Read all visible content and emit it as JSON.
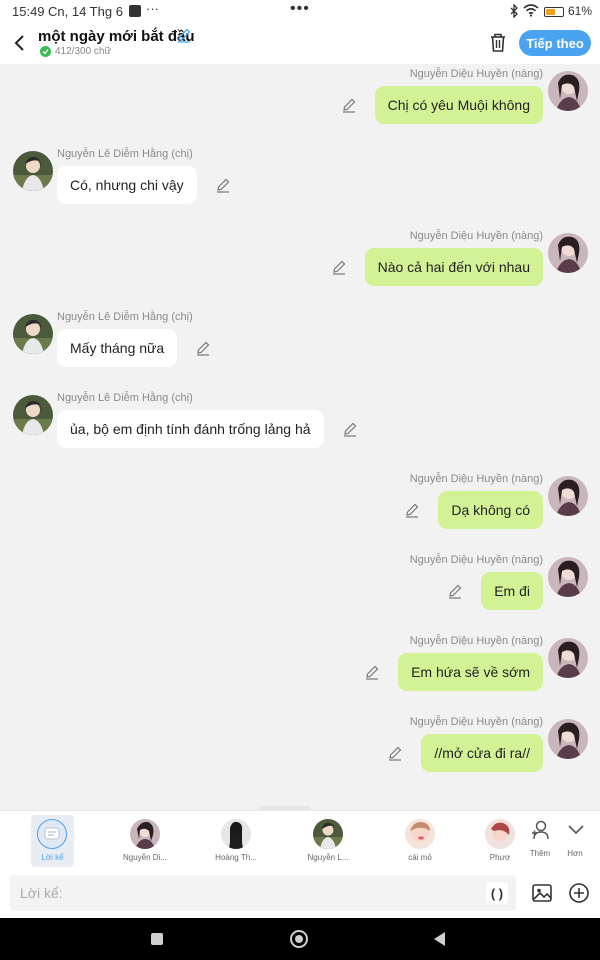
{
  "status_bar": {
    "time": "15:49",
    "date": "Cn, 14 Thg 6",
    "more": "···",
    "battery": "61%",
    "battery_level": 0.61
  },
  "header": {
    "title": "một ngày mới bắt đầu",
    "word_count": "412/300 chữ",
    "next_label": "Tiếp theo"
  },
  "characters": {
    "huyen": "Nguyễn Diệu Huyền (nàng)",
    "hang": "Nguyễn Lê Diễm Hằng (chị)"
  },
  "messages": [
    {
      "side": "right",
      "sender": "Nguyễn Diệu Huyền (nàng)",
      "text": "Chị có yêu Muội không"
    },
    {
      "side": "left",
      "sender": "Nguyễn Lê Diễm Hằng (chị)",
      "text": "Có, nhưng chi vậy"
    },
    {
      "side": "right",
      "sender": "Nguyễn Diệu Huyền (nàng)",
      "text": "Nào cả hai đến với nhau"
    },
    {
      "side": "left",
      "sender": "Nguyễn Lê Diễm Hằng (chị)",
      "text": "Mấy tháng nữa"
    },
    {
      "side": "left",
      "sender": "Nguyễn Lê Diễm Hằng (chị)",
      "text": "ủa, bộ em định tính đánh trống lảng hả"
    },
    {
      "side": "right",
      "sender": "Nguyễn Diệu Huyền (nàng)",
      "text": "Dạ không có"
    },
    {
      "side": "right",
      "sender": "Nguyễn Diệu Huyền (nàng)",
      "text": "Em đi"
    },
    {
      "side": "right",
      "sender": "Nguyễn Diệu Huyền (nàng)",
      "text": "Em hứa sẽ về sớm"
    },
    {
      "side": "right",
      "sender": "Nguyễn Diệu Huyền (nàng)",
      "text": "//mở cửa đi ra//"
    }
  ],
  "roles": [
    {
      "label": "Lời kể",
      "active": true
    },
    {
      "label": "Nguyễn Di...",
      "active": false
    },
    {
      "label": "Hoàng Th...",
      "active": false
    },
    {
      "label": "Nguyễn L...",
      "active": false
    },
    {
      "label": "cái mỏ",
      "active": false
    },
    {
      "label": "Phươ",
      "active": false
    }
  ],
  "role_actions": {
    "add": "Thêm",
    "more": "Hơn"
  },
  "input": {
    "placeholder": "Lời kể:",
    "paren_label": "( )"
  },
  "colors": {
    "accent": "#4aa3f0",
    "right_bubble": "#d3f296",
    "left_bubble": "#ffffff",
    "background": "#f2f2f2"
  }
}
